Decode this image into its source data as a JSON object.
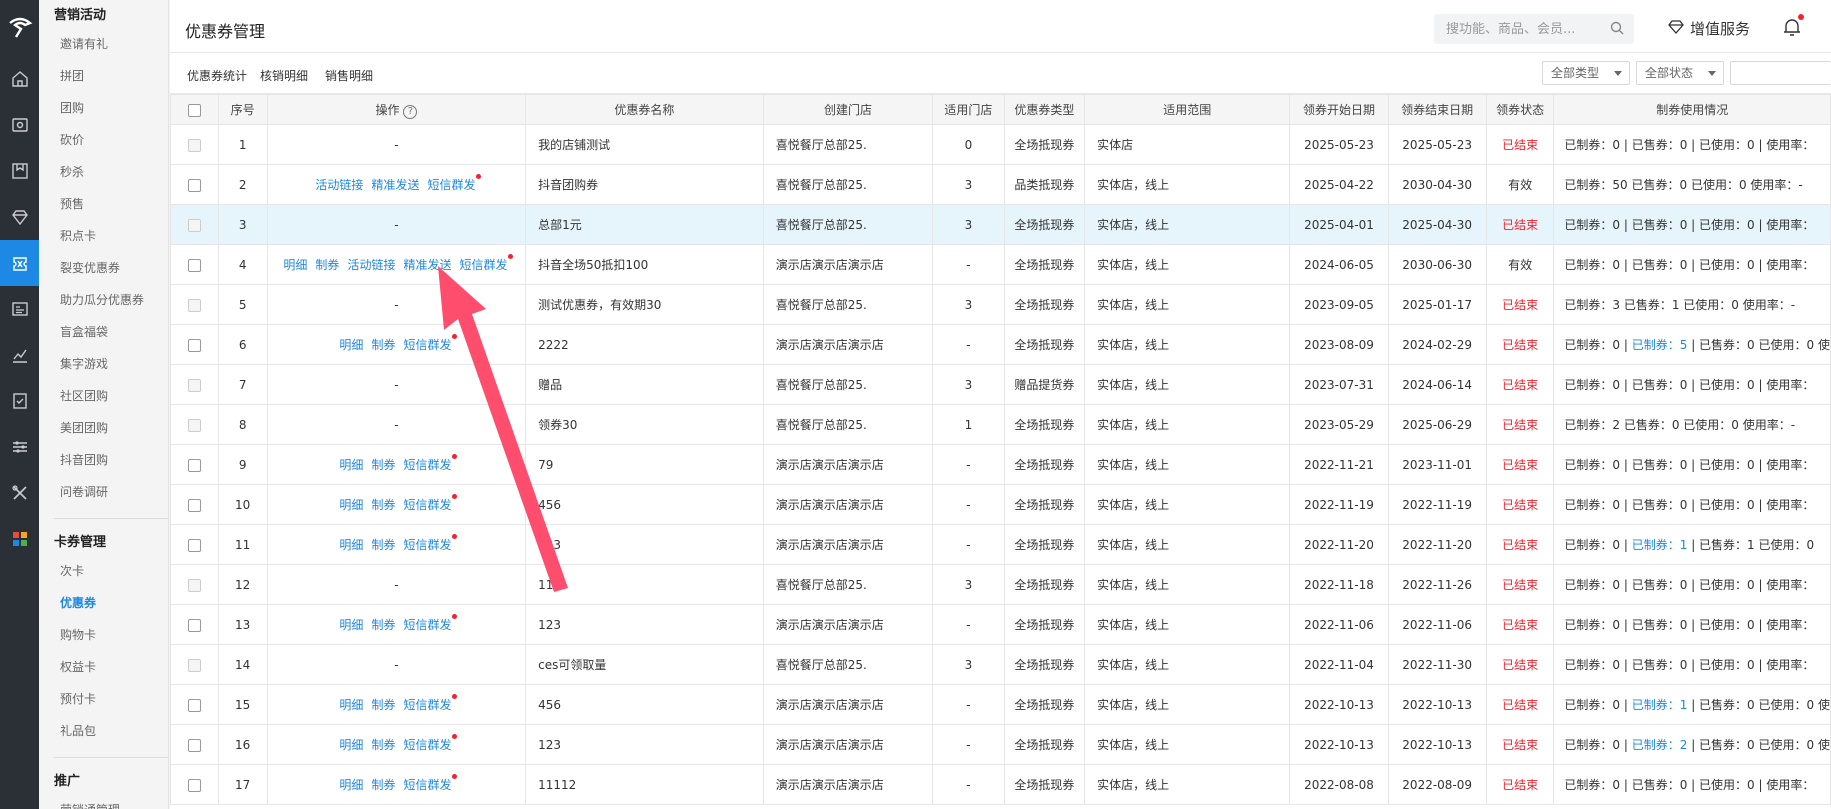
{
  "header": {
    "page_title": "优惠券管理",
    "search_placeholder": "搜功能、商品、会员...",
    "value_added_label": "增值服务"
  },
  "sidebar": {
    "groups": [
      {
        "label": "营销活动",
        "items": [
          "邀请有礼",
          "拼团",
          "团购",
          "砍价",
          "秒杀",
          "预售",
          "积点卡",
          "裂变优惠券",
          "助力瓜分优惠券",
          "盲盒福袋",
          "集字游戏",
          "社区团购",
          "美团团购",
          "抖音团购",
          "问卷调研"
        ]
      },
      {
        "label": "卡券管理",
        "items": [
          "次卡",
          "优惠券",
          "购物卡",
          "权益卡",
          "预付卡",
          "礼品包"
        ]
      },
      {
        "label": "推广",
        "items": [
          "营销通管理"
        ]
      }
    ],
    "active_item": "优惠券"
  },
  "subtabs": [
    "优惠券统计",
    "核销明细",
    "销售明细"
  ],
  "filters": {
    "type": "全部类型",
    "status": "全部状态"
  },
  "table": {
    "columns": [
      "序号",
      "操作",
      "优惠券名称",
      "创建门店",
      "适用门店",
      "优惠券类型",
      "适用范围",
      "领券开始日期",
      "领券结束日期",
      "领券状态",
      "制券使用情况"
    ],
    "rows": [
      {
        "no": "1",
        "ops": [],
        "name": "我的店铺测试",
        "store": "喜悦餐厅总部25.",
        "applicable": "0",
        "type": "全场抵现券",
        "scope": "实体店",
        "start": "2025-05-23",
        "end": "2025-05-23",
        "status": "已结束",
        "usage": "已制券：0 | 已售券：0 | 已使用：0 | 使用率：",
        "usage_link": ""
      },
      {
        "no": "2",
        "ops": [
          "活动链接",
          "精准发送",
          "短信群发"
        ],
        "name": "抖音团购券",
        "store": "喜悦餐厅总部25.",
        "applicable": "3",
        "type": "品类抵现券",
        "scope": "实体店，线上",
        "start": "2025-04-22",
        "end": "2030-04-30",
        "status": "有效",
        "usage": "已制券：50 已售券：0 已使用：0 使用率：-",
        "usage_link": ""
      },
      {
        "no": "3",
        "ops": [],
        "name": "总部1元",
        "store": "喜悦餐厅总部25.",
        "applicable": "3",
        "type": "全场抵现券",
        "scope": "实体店，线上",
        "start": "2025-04-01",
        "end": "2025-04-30",
        "status": "已结束",
        "usage": "已制券：0 | 已售券：0 | 已使用：0 | 使用率：",
        "usage_link": ""
      },
      {
        "no": "4",
        "ops": [
          "明细",
          "制券",
          "活动链接",
          "精准发送",
          "短信群发"
        ],
        "name": "抖音全场50抵扣100",
        "store": "演示店演示店演示店",
        "applicable": "-",
        "type": "全场抵现券",
        "scope": "实体店，线上",
        "start": "2024-06-05",
        "end": "2030-06-30",
        "status": "有效",
        "usage": "已制券：0 | 已售券：0 | 已使用：0 | 使用率：",
        "usage_link": ""
      },
      {
        "no": "5",
        "ops": [],
        "name": "测试优惠券，有效期30",
        "store": "喜悦餐厅总部25.",
        "applicable": "3",
        "type": "全场抵现券",
        "scope": "实体店，线上",
        "start": "2023-09-05",
        "end": "2025-01-17",
        "status": "已结束",
        "usage": "已制券：3 已售券：1 已使用：0 使用率：-",
        "usage_link": ""
      },
      {
        "no": "6",
        "ops": [
          "明细",
          "制券",
          "短信群发"
        ],
        "name": "2222",
        "store": "演示店演示店演示店",
        "applicable": "-",
        "type": "全场抵现券",
        "scope": "实体店，线上",
        "start": "2023-08-09",
        "end": "2024-02-29",
        "status": "已结束",
        "usage": "| 已售券：0 已使用：0 使",
        "usage_link": "已制券：5"
      },
      {
        "no": "7",
        "ops": [],
        "name": "赠品",
        "store": "喜悦餐厅总部25.",
        "applicable": "3",
        "type": "赠品提货券",
        "scope": "实体店，线上",
        "start": "2023-07-31",
        "end": "2024-06-14",
        "status": "已结束",
        "usage": "已制券：0 | 已售券：0 | 已使用：0 | 使用率：",
        "usage_link": ""
      },
      {
        "no": "8",
        "ops": [],
        "name": "领券30",
        "store": "喜悦餐厅总部25.",
        "applicable": "1",
        "type": "全场抵现券",
        "scope": "实体店，线上",
        "start": "2023-05-29",
        "end": "2025-06-29",
        "status": "已结束",
        "usage": "已制券：2 已售券：0 已使用：0 使用率：-",
        "usage_link": ""
      },
      {
        "no": "9",
        "ops": [
          "明细",
          "制券",
          "短信群发"
        ],
        "name": "79",
        "store": "演示店演示店演示店",
        "applicable": "-",
        "type": "全场抵现券",
        "scope": "实体店，线上",
        "start": "2022-11-21",
        "end": "2023-11-01",
        "status": "已结束",
        "usage": "已制券：0 | 已售券：0 | 已使用：0 | 使用率：",
        "usage_link": ""
      },
      {
        "no": "10",
        "ops": [
          "明细",
          "制券",
          "短信群发"
        ],
        "name": "456",
        "store": "演示店演示店演示店",
        "applicable": "-",
        "type": "全场抵现券",
        "scope": "实体店，线上",
        "start": "2022-11-19",
        "end": "2022-11-19",
        "status": "已结束",
        "usage": "已制券：0 | 已售券：0 | 已使用：0 | 使用率：",
        "usage_link": ""
      },
      {
        "no": "11",
        "ops": [
          "明细",
          "制券",
          "短信群发"
        ],
        "name": "123",
        "store": "演示店演示店演示店",
        "applicable": "-",
        "type": "全场抵现券",
        "scope": "实体店，线上",
        "start": "2022-11-20",
        "end": "2022-11-20",
        "status": "已结束",
        "usage": "| 已售券：1 已使用：0",
        "usage_link": "已制券：1"
      },
      {
        "no": "12",
        "ops": [],
        "name": "111",
        "store": "喜悦餐厅总部25.",
        "applicable": "3",
        "type": "全场抵现券",
        "scope": "实体店，线上",
        "start": "2022-11-18",
        "end": "2022-11-26",
        "status": "已结束",
        "usage": "已制券：0 | 已售券：0 | 已使用：0 | 使用率：",
        "usage_link": ""
      },
      {
        "no": "13",
        "ops": [
          "明细",
          "制券",
          "短信群发"
        ],
        "name": "123",
        "store": "演示店演示店演示店",
        "applicable": "-",
        "type": "全场抵现券",
        "scope": "实体店，线上",
        "start": "2022-11-06",
        "end": "2022-11-06",
        "status": "已结束",
        "usage": "已制券：0 | 已售券：0 | 已使用：0 | 使用率：",
        "usage_link": ""
      },
      {
        "no": "14",
        "ops": [],
        "name": "ces可领取量",
        "store": "喜悦餐厅总部25.",
        "applicable": "3",
        "type": "全场抵现券",
        "scope": "实体店，线上",
        "start": "2022-11-04",
        "end": "2022-11-30",
        "status": "已结束",
        "usage": "已制券：0 | 已售券：0 | 已使用：0 | 使用率：",
        "usage_link": ""
      },
      {
        "no": "15",
        "ops": [
          "明细",
          "制券",
          "短信群发"
        ],
        "name": "456",
        "store": "演示店演示店演示店",
        "applicable": "-",
        "type": "全场抵现券",
        "scope": "实体店，线上",
        "start": "2022-10-13",
        "end": "2022-10-13",
        "status": "已结束",
        "usage": "| 已售券：0 已使用：0 使",
        "usage_link": "已制券：1"
      },
      {
        "no": "16",
        "ops": [
          "明细",
          "制券",
          "短信群发"
        ],
        "name": "123",
        "store": "演示店演示店演示店",
        "applicable": "-",
        "type": "全场抵现券",
        "scope": "实体店，线上",
        "start": "2022-10-13",
        "end": "2022-10-13",
        "status": "已结束",
        "usage": "| 已售券：0 已使用：0 使",
        "usage_link": "已制券：2"
      },
      {
        "no": "17",
        "ops": [
          "明细",
          "制券",
          "短信群发"
        ],
        "name": "11112",
        "store": "演示店演示店演示店",
        "applicable": "-",
        "type": "全场抵现券",
        "scope": "实体店，线上",
        "start": "2022-08-08",
        "end": "2022-08-09",
        "status": "已结束",
        "usage": "已制券：0 | 已售券：0 | 已使用：0 | 使用率：",
        "usage_link": ""
      }
    ]
  },
  "colors": {
    "accent": "#1e88e5",
    "ended": "#f5222d",
    "arrow": "#ff4d6d"
  }
}
